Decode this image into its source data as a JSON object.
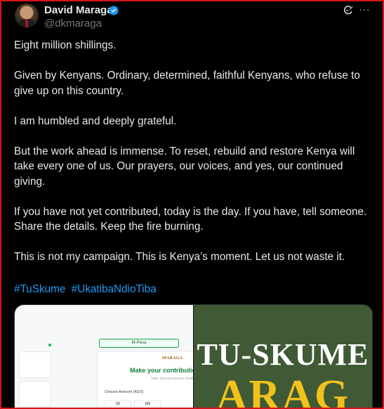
{
  "author": {
    "name": "David Maraga",
    "handle": "@dkmaraga"
  },
  "post": {
    "paragraphs": [
      "Eight million shillings.",
      "Given by Kenyans. Ordinary, determined, faithful Kenyans, who refuse to give up on this country.",
      "I am humbled and deeply grateful.",
      "But the work ahead is immense. To reset, rebuild and restore Kenya will take every one of us. Our prayers, our voices, and yes, our continued giving.",
      "If you have not yet contributed, today is the day. If you have, tell someone. Share the details. Keep the fire burning.",
      "This is not my campaign. This is Kenya’s moment. Let us not waste it."
    ],
    "hashtags": [
      "#TuSkume",
      "#UkatibaNdioTiba"
    ]
  },
  "icons": {
    "verified": "verified-badge-icon",
    "grok": "grok-icon",
    "more": "more-options-icon"
  },
  "colors": {
    "background": "#000000",
    "text": "#e7e9ea",
    "muted": "#71767b",
    "link": "#1d9bf0",
    "frame": "#d6141c"
  },
  "media": {
    "left_image": {
      "mpesa_label": "M-Pesa",
      "logo": "MARAGA",
      "title": "Make your contribution",
      "subtitle": "Safe, fast and secure mobil",
      "choose_amount": "Choose Amount (KES)",
      "amounts": [
        "50",
        "100"
      ]
    },
    "right_image": {
      "line1": "TU-SKUME",
      "line2": "ARAG"
    }
  }
}
